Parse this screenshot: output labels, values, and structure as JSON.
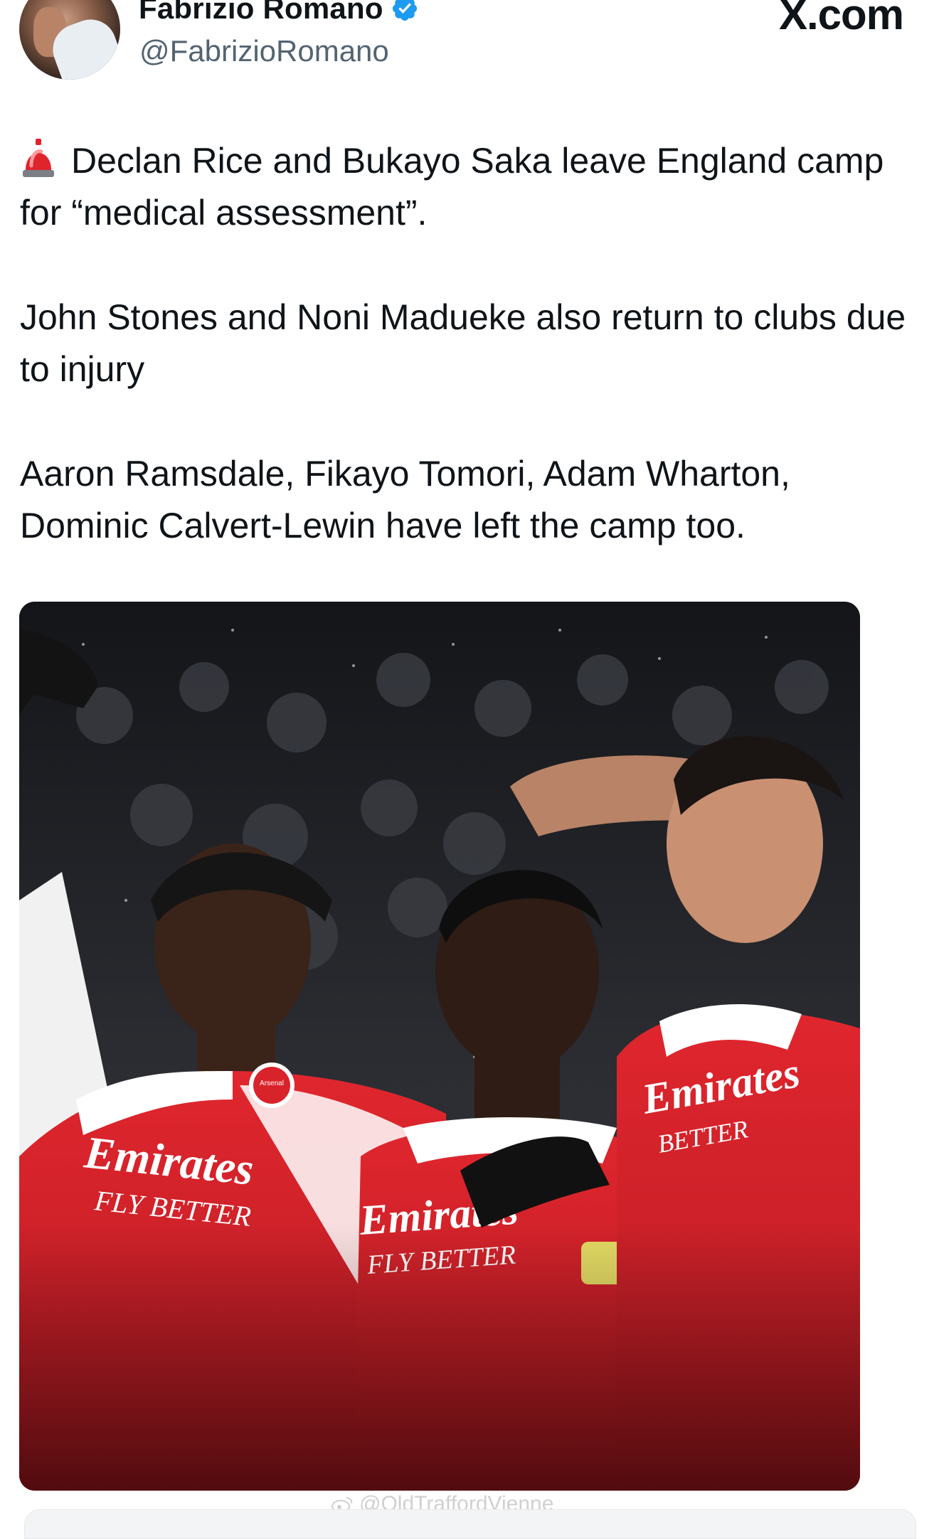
{
  "author": {
    "display_name": "Fabrizio Romano",
    "handle": "@FabrizioRomano",
    "verified": true,
    "avatar_icon": "profile-photo"
  },
  "site_label": "X.com",
  "tweet": {
    "paragraphs": [
      {
        "emoji": "rotating-light-icon",
        "text": "Declan Rice and Bukayo Saka leave England camp for “medical assessment”."
      },
      {
        "text": "John Stones and Noni Madueke also return to clubs due to injury"
      },
      {
        "text": "Aaron Ramsdale, Fikayo Tomori, Adam Wharton, Dominic Calvert-Lewin have left the camp too."
      }
    ]
  },
  "media": {
    "kit_text_left": "Emirates",
    "kit_sub_left": "FLY BETTER",
    "kit_text_mid": "Emirates",
    "kit_sub_mid": "FLY BETTER",
    "kit_text_right": "Emirates",
    "kit_sub_right": "BETTER",
    "badge_text": "Arsenal"
  },
  "watermark": "@OldTraffordVienne",
  "colors": {
    "verified": "#1d9bf0",
    "arsenal_red": "#d9232b",
    "text": "#0f1419",
    "secondary": "#536471"
  }
}
